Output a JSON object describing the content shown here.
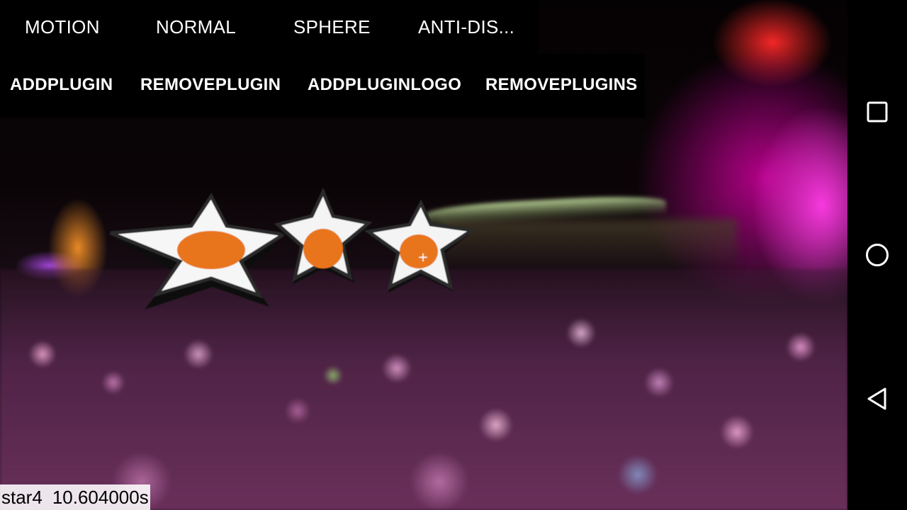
{
  "menu": {
    "row1": [
      "MOTION",
      "NORMAL",
      "SPHERE",
      "ANTI-DIS..."
    ],
    "row2": [
      "ADDPLUGIN",
      "REMOVEPLUGIN",
      "ADDPLUGINLOGO",
      "REMOVEPLUGINS"
    ]
  },
  "status": {
    "plugin_name": "star4",
    "time": "10.604000s"
  },
  "plugins": {
    "star_marker": "+"
  },
  "navbar": {
    "recents_icon": "square-icon",
    "home_icon": "circle-icon",
    "back_icon": "triangle-back-icon"
  },
  "colors": {
    "star_fill": "#f4f4f4",
    "star_center": "#e8741c",
    "menu_text": "#ffffff"
  }
}
